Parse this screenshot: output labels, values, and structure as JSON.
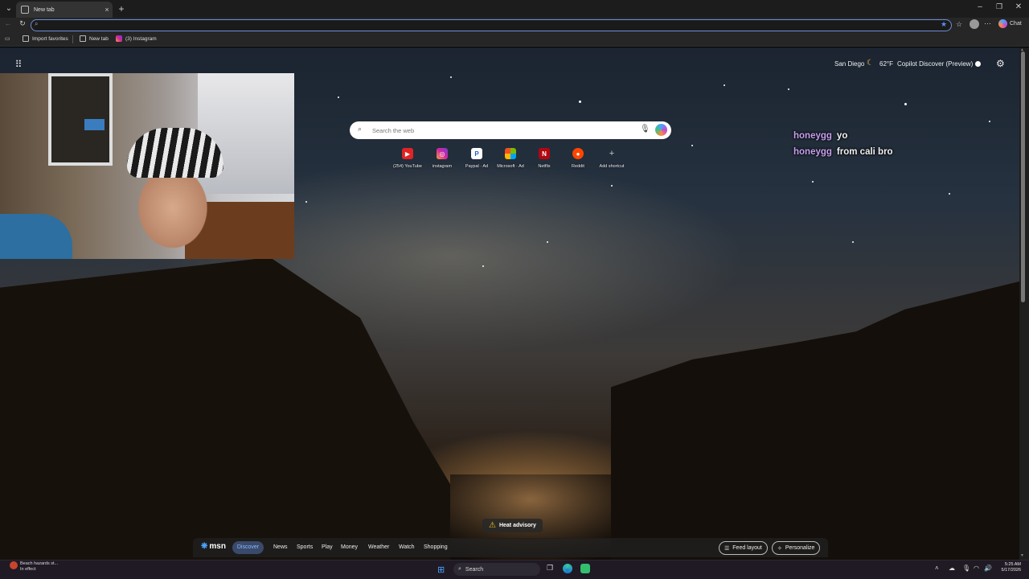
{
  "browser": {
    "tab_title": "New tab",
    "tab_close": "×",
    "new_tab": "+",
    "window_controls": {
      "minimize": "–",
      "maximize": "❐",
      "close": "✕"
    },
    "address_placeholder": "",
    "copilot_label": "Chat"
  },
  "favorites": [
    {
      "label": "Import favorites",
      "icon": "folder-icon"
    },
    {
      "label": "New tab",
      "icon": "page-icon"
    },
    {
      "label": "(3) Instagram",
      "icon": "instagram-icon"
    }
  ],
  "header": {
    "weather_location": "San Diego",
    "weather_temp": "62°F",
    "copilot_discover": "Copilot Discover (Preview)"
  },
  "search": {
    "placeholder": "Search the web"
  },
  "shortcuts": [
    {
      "label": "(254) YouTube",
      "icon": "youtube-icon",
      "color": "#e02424",
      "glyph": "▶"
    },
    {
      "label": "instagram",
      "icon": "instagram-icon",
      "color": "#d6249f",
      "glyph": "◎"
    },
    {
      "label": "Paypal · Ad",
      "icon": "paypal-icon",
      "color": "#1f5fbf",
      "glyph": "P"
    },
    {
      "label": "Microsoft · Ad",
      "icon": "microsoft-icon",
      "color": "#f25022",
      "glyph": "■"
    },
    {
      "label": "Netflix",
      "icon": "netflix-icon",
      "color": "#b20710",
      "glyph": "N"
    },
    {
      "label": "Reddit",
      "icon": "reddit-icon",
      "color": "#ff4500",
      "glyph": "●"
    },
    {
      "label": "Add shortcut",
      "icon": "plus-icon",
      "color": "transparent",
      "glyph": "+"
    }
  ],
  "chat": [
    {
      "user": "honeygg",
      "message": "yo"
    },
    {
      "user": "honeygg",
      "message": "from cali bro"
    }
  ],
  "alert": {
    "label": "Heat advisory"
  },
  "msn_bar": {
    "logo": "msn",
    "active_tab": "Discover",
    "tabs": [
      "News",
      "Sports",
      "Play",
      "Money",
      "Weather",
      "Watch",
      "Shopping"
    ],
    "feed_layout": "Feed layout",
    "personalize": "Personalize"
  },
  "taskbar": {
    "weather_line1": "Beach hazards st...",
    "weather_line2": "In effect",
    "search_label": "Search",
    "time": "5:25 AM",
    "date": "5/17/2026"
  }
}
